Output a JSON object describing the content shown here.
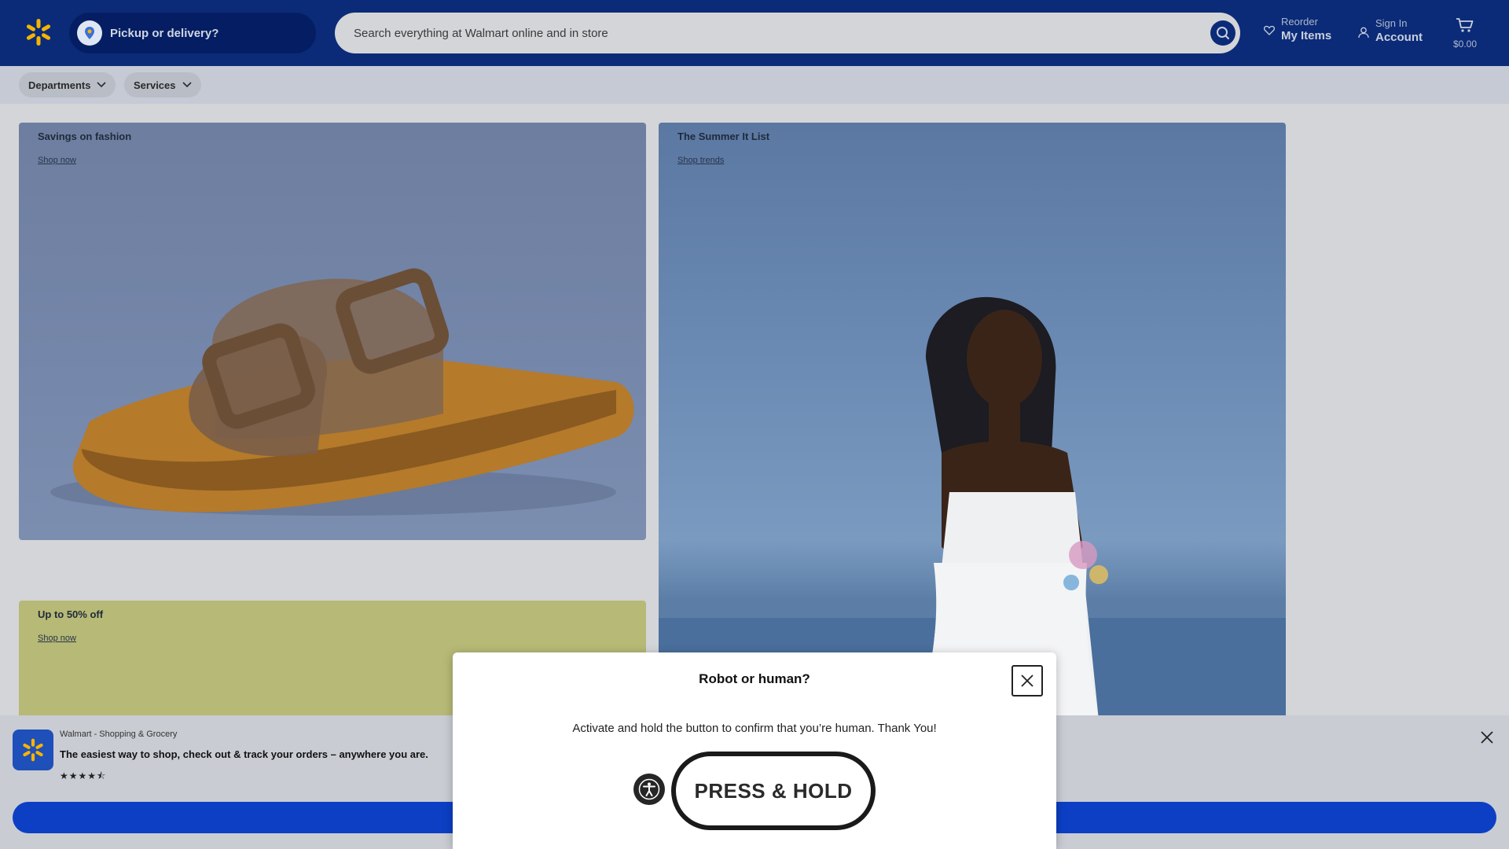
{
  "header": {
    "pickup_label": "Pickup or delivery?",
    "search_placeholder": "Search everything at Walmart online and in store",
    "reorder_small": "Reorder",
    "reorder_big": "My Items",
    "signin_small": "Sign In",
    "signin_big": "Account",
    "cart_total": "$0.00",
    "icons": [
      "spark-logo-icon",
      "location-icon",
      "search-icon",
      "heart-icon",
      "user-icon",
      "cart-icon"
    ]
  },
  "nav": {
    "departments": "Departments",
    "services": "Services"
  },
  "cards": {
    "fashion": {
      "title": "Savings on fashion",
      "link": "Shop now"
    },
    "summer": {
      "title": "The Summer It List",
      "link": "Shop trends"
    },
    "sale": {
      "title": "Up to 50% off",
      "link": "Shop now"
    }
  },
  "app_banner": {
    "name": "Walmart - Shopping & Grocery",
    "description": "The easiest way to shop, check out & track your orders – anywhere you are.",
    "rating_stars": "★★★★⯪",
    "rating": 4.5
  },
  "modal": {
    "title": "Robot or human?",
    "message": "Activate and hold the button to confirm that you’re human. Thank You!",
    "button": "PRESS & HOLD"
  },
  "colors": {
    "header_bg": "#0b2b78",
    "accent_yellow": "#f5b400",
    "button_blue": "#0c3fc4"
  }
}
